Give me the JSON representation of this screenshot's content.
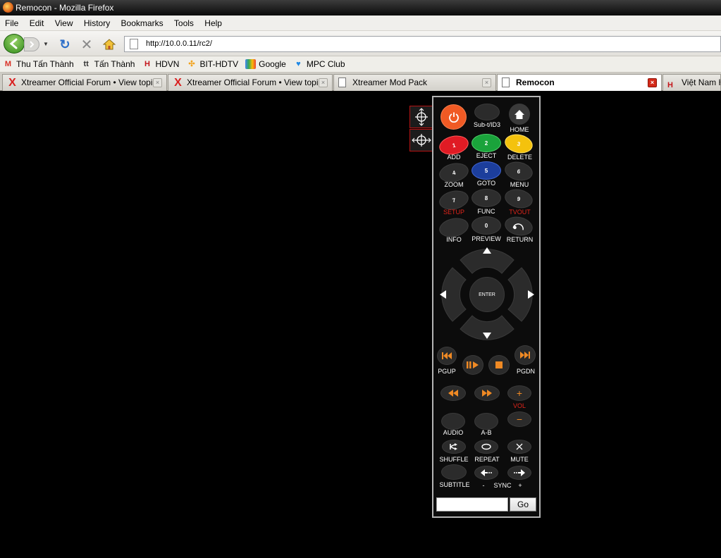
{
  "window": {
    "title": "Remocon - Mozilla Firefox"
  },
  "menu": {
    "items": [
      "File",
      "Edit",
      "View",
      "History",
      "Bookmarks",
      "Tools",
      "Help"
    ]
  },
  "nav": {
    "url": "http://10.0.0.11/rc2/"
  },
  "bookmarks": [
    {
      "label": "Thu Tấn Thành",
      "icon": "gmail-icon",
      "color": "#d93025"
    },
    {
      "label": "Tấn Thành",
      "icon": "tt-icon",
      "color": "#333333"
    },
    {
      "label": "HDVN",
      "icon": "hdvn-icon",
      "color": "#c4161c"
    },
    {
      "label": "BIT-HDTV",
      "icon": "bit-icon",
      "color": "#f2a21b"
    },
    {
      "label": "Google",
      "icon": "google-icon",
      "color": "#4285f4"
    },
    {
      "label": "MPC Club",
      "icon": "heart-icon",
      "color": "#1e88e5"
    }
  ],
  "tabs": [
    {
      "label": "Xtreamer Official Forum • View topi...",
      "active": false
    },
    {
      "label": "Xtreamer Official Forum • View topi...",
      "active": false
    },
    {
      "label": "Xtreamer Mod Pack",
      "active": false
    },
    {
      "label": "Remocon",
      "active": true
    },
    {
      "label": "Việt Nam H",
      "active": false
    }
  ],
  "remote": {
    "colors": {
      "power": "#f05a24",
      "red": "#e01b24",
      "green": "#1aa33b",
      "yellow": "#f4c20d",
      "blue": "#1c3e9c",
      "accent": "#f08a24"
    },
    "row1": {
      "sub": "Sub-t/ID3",
      "home": "HOME"
    },
    "row2": {
      "k1": "1",
      "k2": "2",
      "k3": "3",
      "add": "ADD",
      "eject": "EJECT",
      "delete": "DELETE"
    },
    "row3": {
      "k4": "4",
      "k5": "5",
      "k6": "6",
      "zoom": "ZOOM",
      "goto": "GOTO",
      "menu": "MENU"
    },
    "row4": {
      "k7": "7",
      "k8": "8",
      "k9": "9",
      "setup": "SETUP",
      "func": "FUNC",
      "tvout": "TVOUT"
    },
    "row5": {
      "k0": "0",
      "info": "INFO",
      "preview": "PREVIEW",
      "return": "RETURN"
    },
    "enter": "ENTER",
    "transport": {
      "pgup": "PGUP",
      "pgdn": "PGDN"
    },
    "vol": {
      "label": "VOL",
      "plus": "+",
      "minus": "−"
    },
    "row6": {
      "audio": "AUDIO",
      "ab": "A-B"
    },
    "row7": {
      "shuffle": "SHUFFLE",
      "repeat": "REPEAT",
      "mute": "MUTE"
    },
    "row8": {
      "subtitle": "SUBTITLE",
      "sync_minus": "-",
      "sync": "SYNC",
      "sync_plus": "+"
    },
    "go": {
      "button": "Go",
      "value": ""
    }
  }
}
